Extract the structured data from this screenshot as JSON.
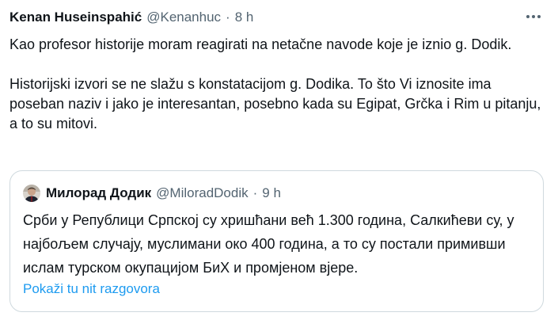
{
  "tweet": {
    "author_name": "Kenan Huseinspahić",
    "handle": "@Kenanhuc",
    "separator": "·",
    "time": "8 h",
    "paragraph_1": "Kao profesor historije moram reagirati na netačne navode koje je iznio g. Dodik.",
    "paragraph_2": "Historijski izvori se ne slažu s konstatacijom g. Dodika. To što Vi iznosite ima poseban naziv i jako je interesantan, posebno kada su Egipat, Grčka i Rim u pitanju, a to su mitovi."
  },
  "quote": {
    "author_name": "Милорад Додик",
    "handle": "@MiloradDodik",
    "separator": "·",
    "time": "9 h",
    "text": "Срби у Републици Српској су хришћани већ 1.300 година, Салкићеви су, у најбољем случају, муслимани око 400 година, а то су постали примивши ислам турском окупацијом БиХ и промјеном вјере.",
    "show_thread_label": "Pokaži tu nit razgovora"
  },
  "icons": {
    "more": "more-horizontal-icon",
    "avatar": "avatar-photo"
  },
  "colors": {
    "text": "#0f1419",
    "secondary": "#536471",
    "link": "#1d9bf0",
    "border": "#cfd9de"
  }
}
